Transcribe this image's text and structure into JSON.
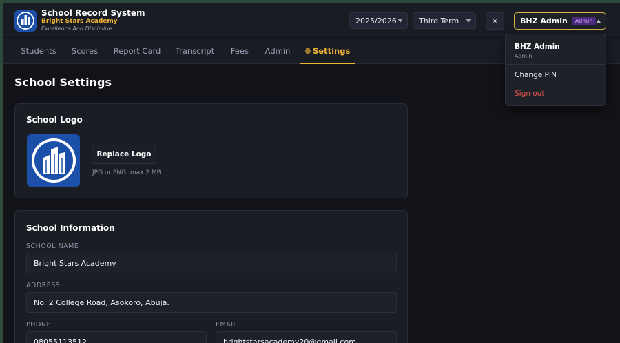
{
  "app": {
    "title": "School Record System",
    "school": "Bright Stars Academy",
    "motto": "Excellence And Discipline"
  },
  "header": {
    "session_select": "2025/2026",
    "term_select": "Third Term",
    "theme_icon": "sun-icon",
    "user": {
      "name": "BHZ Admin",
      "role_badge": "Admin"
    }
  },
  "tabs": [
    {
      "label": "Students",
      "active": false
    },
    {
      "label": "Scores",
      "active": false
    },
    {
      "label": "Report Card",
      "active": false
    },
    {
      "label": "Transcript",
      "active": false
    },
    {
      "label": "Fees",
      "active": false
    },
    {
      "label": "Admin",
      "active": false
    },
    {
      "label": "Settings",
      "active": true,
      "icon": "gear-icon"
    }
  ],
  "page": {
    "title": "School Settings"
  },
  "logo_card": {
    "title": "School Logo",
    "replace_label": "Replace Logo",
    "hint": "JPG or PNG, max 2 MB"
  },
  "info_card": {
    "title": "School Information",
    "fields": {
      "school_name": {
        "label": "SCHOOL NAME",
        "value": "Bright Stars Academy"
      },
      "address": {
        "label": "ADDRESS",
        "value": "No. 2 College Road, Asokoro, Abuja."
      },
      "phone": {
        "label": "PHONE",
        "value": "08055113512"
      },
      "email": {
        "label": "EMAIL",
        "value": "brightstarsacademy20@gmail.com"
      }
    }
  },
  "user_menu": {
    "name": "BHZ Admin",
    "role": "Admin",
    "change_pin": "Change PIN",
    "sign_out": "Sign out"
  },
  "colors": {
    "accent": "#f0b537",
    "background": "#121318",
    "card": "#1b1d25",
    "danger": "#e0554f",
    "logo_blue": "#1c4fa8"
  }
}
